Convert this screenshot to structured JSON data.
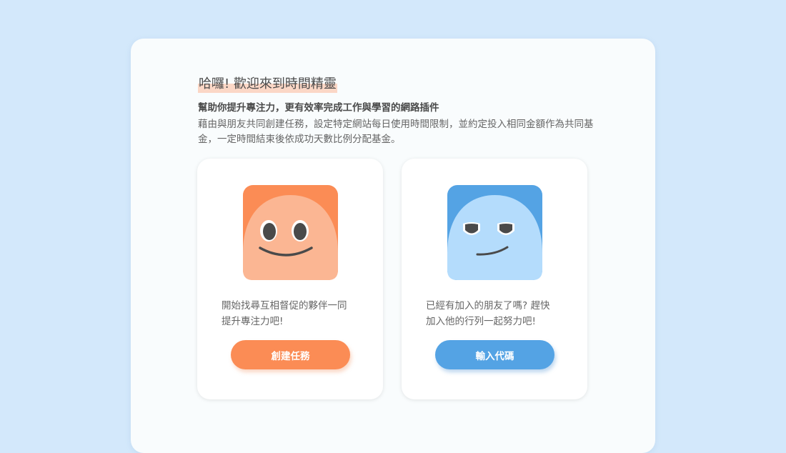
{
  "welcome": {
    "title": "哈囉! 歡迎來到時間精靈",
    "subtitle": "幫助你提升專注力，更有效率完成工作與學習的網路插件",
    "description": "藉由與朋友共同創建任務，設定特定網站每日使用時間限制，並約定投入相同金額作為共同基金，一定時間結束後依成功天數比例分配基金。"
  },
  "cards": {
    "create": {
      "text_line1": "開始找尋互相督促的夥伴一同",
      "text_line2": "提升專注力吧!",
      "button_label": "創建任務",
      "avatar_icon": "orange-smiling-blob-icon",
      "accent_color": "#fb8c55"
    },
    "join": {
      "text_line1": "已經有加入的朋友了嗎? 趕快",
      "text_line2": "加入他的行列一起努力吧!",
      "button_label": "輸入代碼",
      "avatar_icon": "blue-smirking-blob-icon",
      "accent_color": "#54a3e4"
    }
  },
  "colors": {
    "background": "#d3e8fb",
    "panel": "#f9fcfd",
    "title_highlight": "#fbd7c6"
  }
}
